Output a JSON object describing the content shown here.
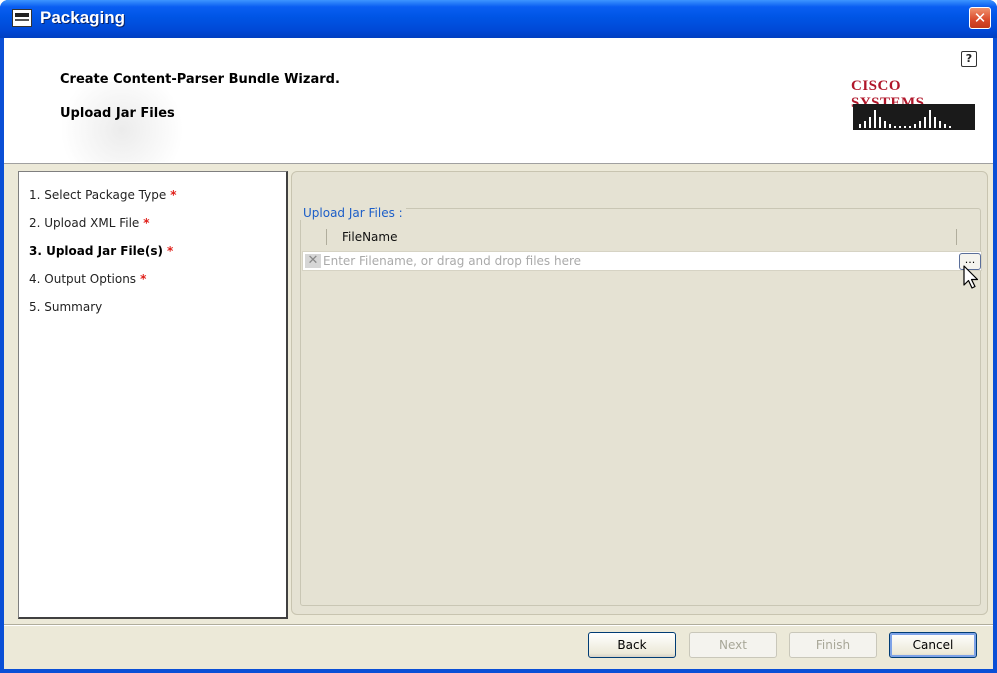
{
  "window": {
    "title": "Packaging",
    "close_label": "✕"
  },
  "header": {
    "wizard_title": "Create Content-Parser Bundle Wizard.",
    "step_title": "Upload Jar Files",
    "help_label": "?",
    "logo_text": "CISCO SYSTEMS"
  },
  "steps": [
    {
      "label": "1. Select Package Type",
      "required": "*"
    },
    {
      "label": "2. Upload XML File",
      "required": "*"
    },
    {
      "label": "3. Upload Jar File(s)",
      "required": "*"
    },
    {
      "label": "4. Output Options",
      "required": "*"
    },
    {
      "label": "5. Summary",
      "required": ""
    }
  ],
  "upload": {
    "group_label": "Upload Jar Files :",
    "column_header": "FileName",
    "placeholder": "Enter Filename, or drag and drop files here",
    "browse_label": "..."
  },
  "buttons": {
    "back": "Back",
    "next": "Next",
    "finish": "Finish",
    "cancel": "Cancel"
  },
  "colors": {
    "title_bar": "#0055e5",
    "required_marker": "#e0201a",
    "group_label": "#1c5ec8",
    "logo": "#b0162a"
  },
  "icons": [
    "app-icon",
    "close-icon",
    "help-icon",
    "cisco-logo",
    "remove-icon",
    "browse-icon",
    "cursor-icon"
  ]
}
